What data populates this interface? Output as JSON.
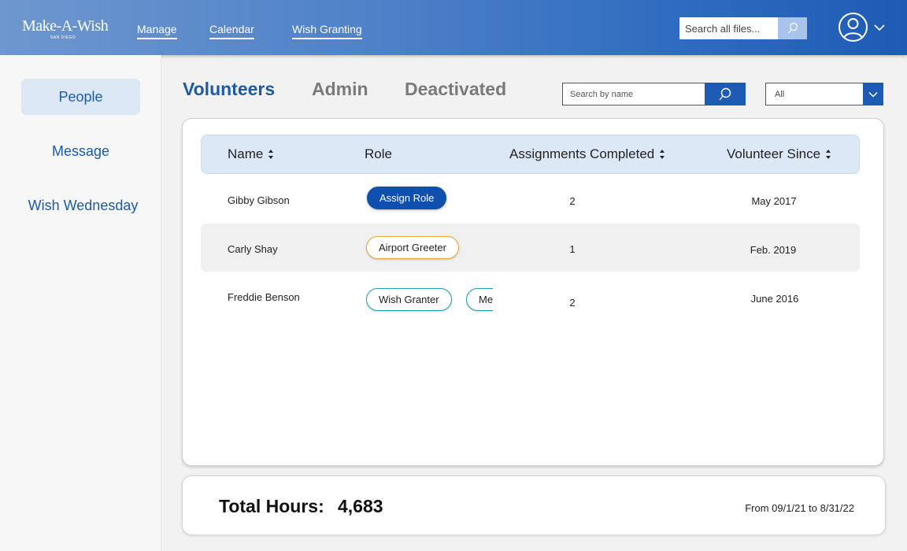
{
  "header": {
    "logo": "Make-A-Wish",
    "logo_sub": "SAN DIEGO",
    "nav": [
      "Manage",
      "Calendar",
      "Wish Granting"
    ],
    "search_placeholder": "Search all files..."
  },
  "sidebar": {
    "items": [
      {
        "label": "People",
        "active": true
      },
      {
        "label": "Message",
        "active": false
      },
      {
        "label": "Wish Wednesday",
        "active": false
      }
    ]
  },
  "tabs": [
    "Volunteers",
    "Admin",
    "Deactivated"
  ],
  "name_search_placeholder": "Search by name",
  "filter": {
    "selected": "All"
  },
  "table": {
    "columns": [
      "Name",
      "Role",
      "Assignments Completed",
      "Volunteer Since"
    ],
    "rows": [
      {
        "name": "Gibby Gibson",
        "roles": [
          "Assign Role"
        ],
        "assignments": "2",
        "since": "May 2017"
      },
      {
        "name": "Carly Shay",
        "roles": [
          "Airport Greeter"
        ],
        "assignments": "1",
        "since": "Feb. 2019"
      },
      {
        "name": "Freddie Benson",
        "roles": [
          "Wish Granter",
          "Me"
        ],
        "assignments": "2",
        "since": "June 2016"
      }
    ]
  },
  "totals": {
    "label": "Total Hours:",
    "value": "4,683",
    "range": "From 09/1/21 to 8/31/22"
  },
  "colors": {
    "brand_blue": "#1e5bb5",
    "link_blue": "#1c5aa8",
    "chip_orange": "#f0a830",
    "chip_teal": "#17a3b8"
  },
  "icons": [
    "search-icon",
    "user-avatar-icon",
    "chevron-down-icon",
    "sort-icon"
  ]
}
